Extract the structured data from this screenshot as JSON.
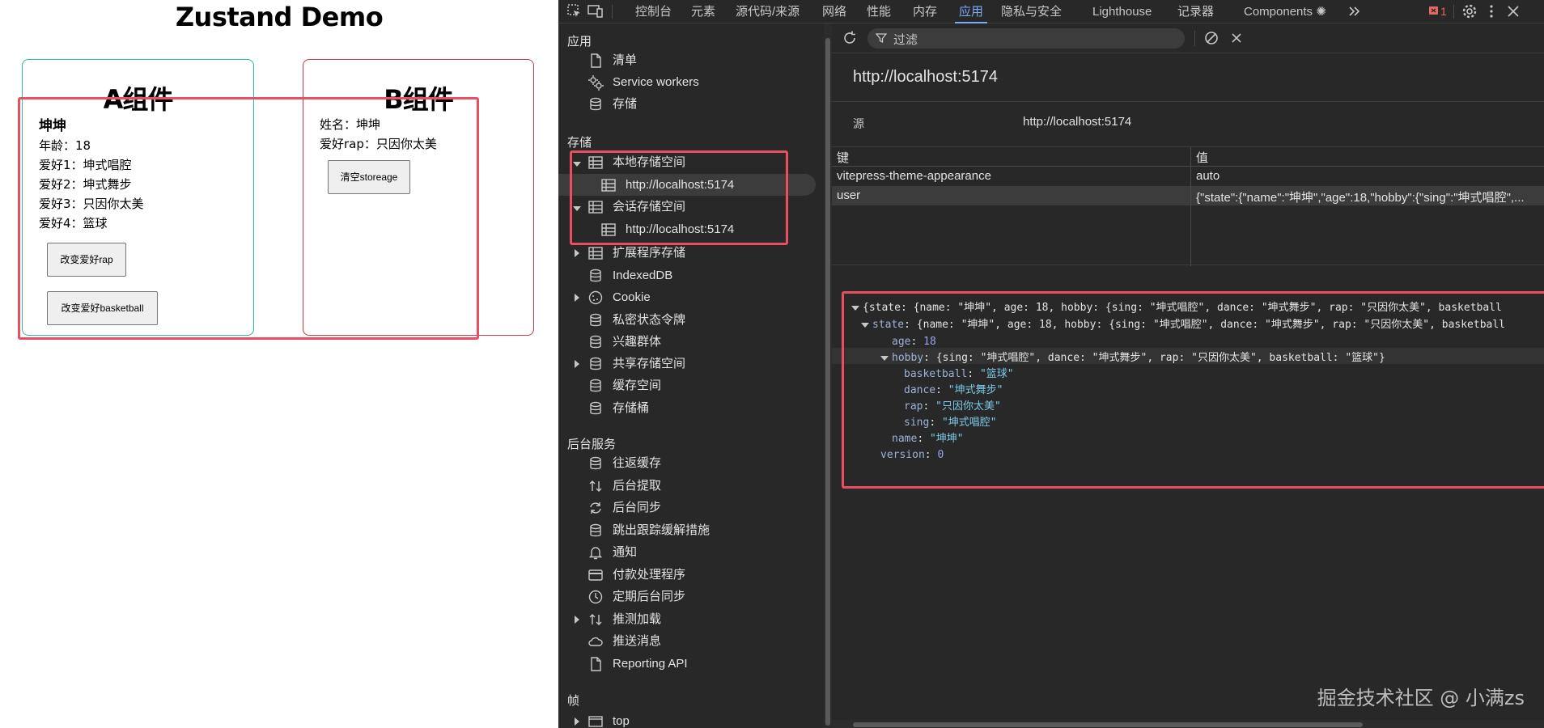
{
  "page": {
    "title": "Zustand Demo",
    "component_a": {
      "heading": "A组件",
      "name": "坤坤",
      "age": "年龄：18",
      "hobby1": "爱好1：坤式唱腔",
      "hobby2": "爱好2：坤式舞步",
      "hobby3": "爱好3：只因你太美",
      "hobby4": "爱好4：篮球",
      "btn_rap": "改变爱好rap",
      "btn_basketball": "改变爱好basketball"
    },
    "component_b": {
      "heading": "B组件",
      "name_line": "姓名：坤坤",
      "rap_line": "爱好rap：只因你太美",
      "btn_clear": "清空storeage"
    }
  },
  "devtools": {
    "tabs": [
      "控制台",
      "元素",
      "源代码/来源",
      "网络",
      "性能",
      "内存",
      "应用",
      "隐私与安全",
      "Lighthouse",
      "记录器",
      "Components ✺"
    ],
    "active_tab": "应用",
    "error_count": "1",
    "sidebar": {
      "app_title": "应用",
      "app_items": [
        "清单",
        "Service workers",
        "存储"
      ],
      "storage_title": "存储",
      "local_storage": "本地存储空间",
      "local_origin": "http://localhost:5174",
      "session_storage": "会话存储空间",
      "session_origin": "http://localhost:5174",
      "storage_items": [
        "扩展程序存储",
        "IndexedDB",
        "Cookie",
        "私密状态令牌",
        "兴趣群体",
        "共享存储空间",
        "缓存空间",
        "存储桶"
      ],
      "bg_title": "后台服务",
      "bg_items": [
        "往返缓存",
        "后台提取",
        "后台同步",
        "跳出跟踪缓解措施",
        "通知",
        "付款处理程序",
        "定期后台同步",
        "推测加载",
        "推送消息",
        "Reporting API"
      ],
      "frames_title": "帧",
      "frame_top": "top"
    },
    "filter_placeholder": "过滤",
    "origin_title": "http://localhost:5174",
    "origin_label": "源",
    "origin_value": "http://localhost:5174",
    "table": {
      "key_header": "键",
      "value_header": "值",
      "rows": [
        {
          "key": "vitepress-theme-appearance",
          "value": "auto"
        },
        {
          "key": "user",
          "value": "{\"state\":{\"name\":\"坤坤\",\"age\":18,\"hobby\":{\"sing\":\"坤式唱腔\",..."
        }
      ]
    },
    "preview": {
      "line0": "{state: {name: \"坤坤\", age: 18, hobby: {sing: \"坤式唱腔\", dance: \"坤式舞步\", rap: \"只因你太美\", basketball",
      "line1_key": "state",
      "line1_rest": ": {name: \"坤坤\", age: 18, hobby: {sing: \"坤式唱腔\", dance: \"坤式舞步\", rap: \"只因你太美\", basketball",
      "age_key": "age",
      "age_val": "18",
      "hobby_key": "hobby",
      "hobby_rest": ": {sing: \"坤式唱腔\", dance: \"坤式舞步\", rap: \"只因你太美\", basketball: \"篮球\"}",
      "basketball_key": "basketball",
      "basketball_val": "\"篮球\"",
      "dance_key": "dance",
      "dance_val": "\"坤式舞步\"",
      "rap_key": "rap",
      "rap_val": "\"只因你太美\"",
      "sing_key": "sing",
      "sing_val": "\"坤式唱腔\"",
      "name_key": "name",
      "name_val": "\"坤坤\"",
      "version_key": "version",
      "version_val": "0"
    },
    "watermark": "掘金技术社区 @ 小满zs"
  }
}
